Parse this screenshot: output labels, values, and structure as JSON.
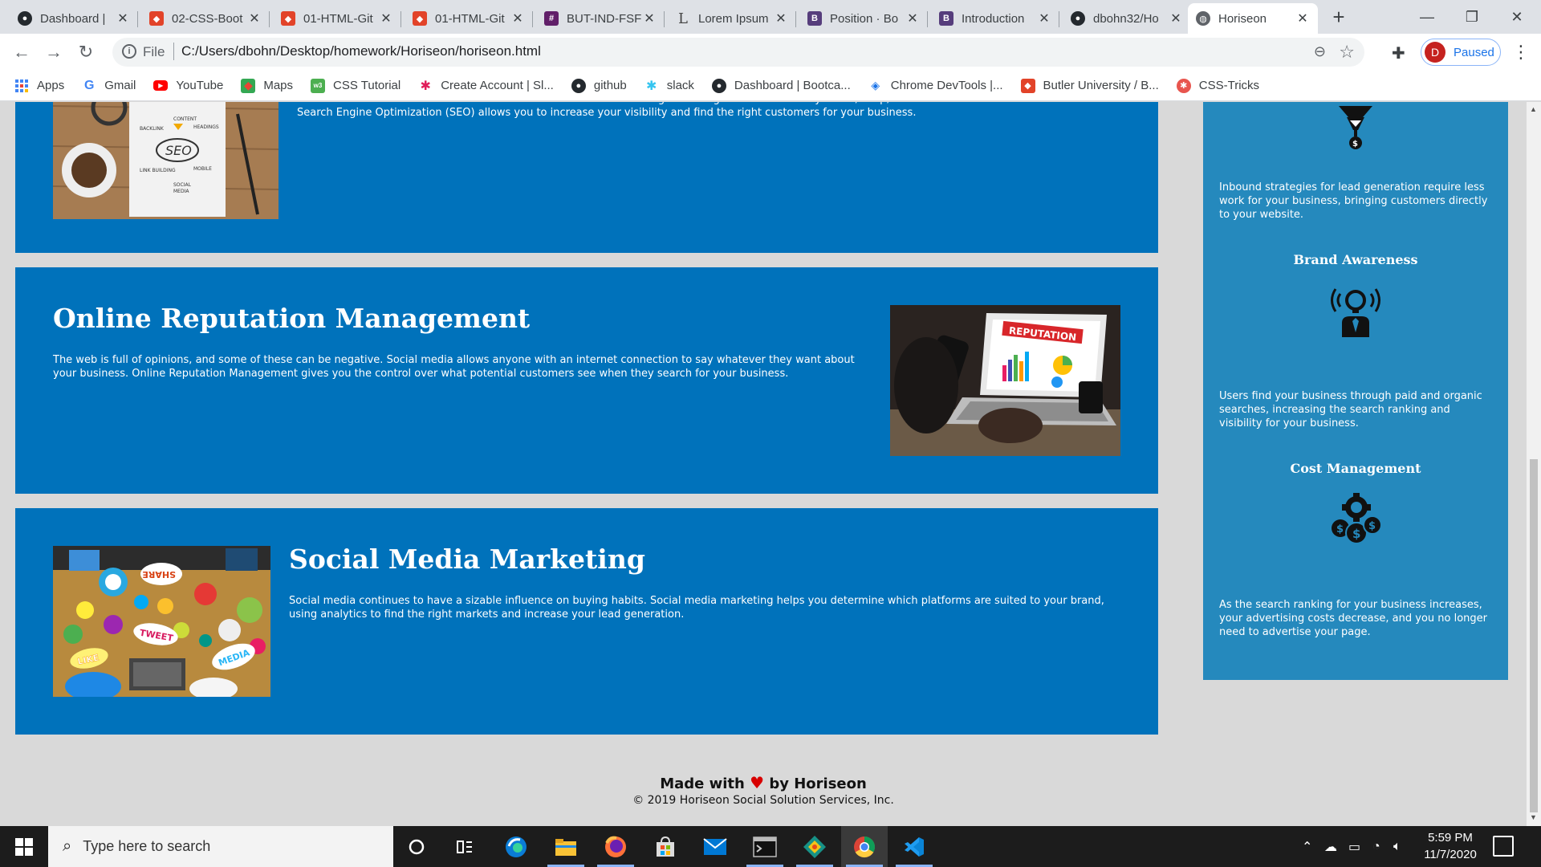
{
  "browser": {
    "tabs": [
      {
        "title": "Dashboard |",
        "favicon": "github-icon",
        "color": "#24292e"
      },
      {
        "title": "02-CSS-Boot",
        "favicon": "gitlab-icon",
        "color": "#e24329"
      },
      {
        "title": "01-HTML-Git",
        "favicon": "gitlab-icon",
        "color": "#e24329"
      },
      {
        "title": "01-HTML-Git",
        "favicon": "gitlab-icon",
        "color": "#e24329"
      },
      {
        "title": "BUT-IND-FSF",
        "favicon": "slack-icon",
        "color": "#611f69"
      },
      {
        "title": "Lorem Ipsum",
        "favicon": "lorem-icon",
        "color": "#444444"
      },
      {
        "title": "Position · Bo",
        "favicon": "bootstrap-icon",
        "color": "#563d7c"
      },
      {
        "title": "Introduction",
        "favicon": "bootstrap-icon",
        "color": "#563d7c"
      },
      {
        "title": "dbohn32/Ho",
        "favicon": "github-icon",
        "color": "#24292e"
      },
      {
        "title": "Horiseon",
        "favicon": "globe-icon",
        "color": "#5f6368",
        "active": true
      }
    ],
    "new_tab": "+",
    "address": {
      "scheme": "File",
      "url": "C:/Users/dbohn/Desktop/homework/Horiseon/horiseon.html"
    },
    "profile": {
      "initial": "D",
      "status": "Paused"
    },
    "bookmarks": [
      {
        "label": "Apps",
        "icon": "apps-grid-icon",
        "color": "#4285f4"
      },
      {
        "label": "Gmail",
        "icon": "google-icon",
        "color": "#4285f4"
      },
      {
        "label": "YouTube",
        "icon": "youtube-icon",
        "color": "#ff0000"
      },
      {
        "label": "Maps",
        "icon": "maps-icon",
        "color": "#34a853"
      },
      {
        "label": "CSS Tutorial",
        "icon": "w3schools-icon",
        "color": "#4caf50"
      },
      {
        "label": "Create Account | Sl...",
        "icon": "slack-icon",
        "color": "#e01e5a"
      },
      {
        "label": "github",
        "icon": "github-icon",
        "color": "#24292e"
      },
      {
        "label": "slack",
        "icon": "slack-icon",
        "color": "#36c5f0"
      },
      {
        "label": "Dashboard | Bootca...",
        "icon": "github-icon",
        "color": "#24292e"
      },
      {
        "label": "Chrome DevTools |...",
        "icon": "devtools-icon",
        "color": "#1a73e8"
      },
      {
        "label": "Butler University / B...",
        "icon": "gitlab-icon",
        "color": "#e24329"
      },
      {
        "label": "CSS-Tricks",
        "icon": "css-tricks-icon",
        "color": "#e8554e"
      }
    ]
  },
  "page": {
    "colors": {
      "card": "#0072bb",
      "sidebar": "#2589bd",
      "background": "#d9d9d9"
    },
    "seo": {
      "text": "The dominance of mobile internet use means that users are searching for the right business as they travel, shop, or sit on their couch at home. Search Engine Optimization (SEO) allows you to increase your visibility and find the right customers for your business."
    },
    "reputation": {
      "title": "Online Reputation Management",
      "text": "The web is full of opinions, and some of these can be negative. Social media allows anyone with an internet connection to say whatever they want about your business. Online Reputation Management gives you the control over what potential customers see when they search for your business.",
      "image_text": "REPUTATION"
    },
    "social": {
      "title": "Social Media Marketing",
      "text": "Social media continues to have a sizable influence on buying habits. Social media marketing helps you determine which platforms are suited to your brand, using analytics to find the right markets and increase your lead generation.",
      "image_words": [
        "SHARE",
        "TWEET",
        "LIKE",
        "MEDIA"
      ]
    },
    "benefits": {
      "lead": {
        "text": "Inbound strategies for lead generation require less work for your business, bringing customers directly to your website."
      },
      "brand": {
        "title": "Brand Awareness",
        "text": "Users find your business through paid and organic searches, increasing the search ranking and visibility for your business."
      },
      "cost": {
        "title": "Cost Management",
        "text": "As the search ranking for your business increases, your advertising costs decrease, and you no longer need to advertise your page."
      }
    },
    "footer": {
      "made_prefix": "Made with",
      "made_suffix": "by Horiseon",
      "copyright": "© 2019 Horiseon Social Solution Services, Inc."
    }
  },
  "taskbar": {
    "search_placeholder": "Type here to search",
    "time": "5:59 PM",
    "date": "11/7/2020"
  }
}
